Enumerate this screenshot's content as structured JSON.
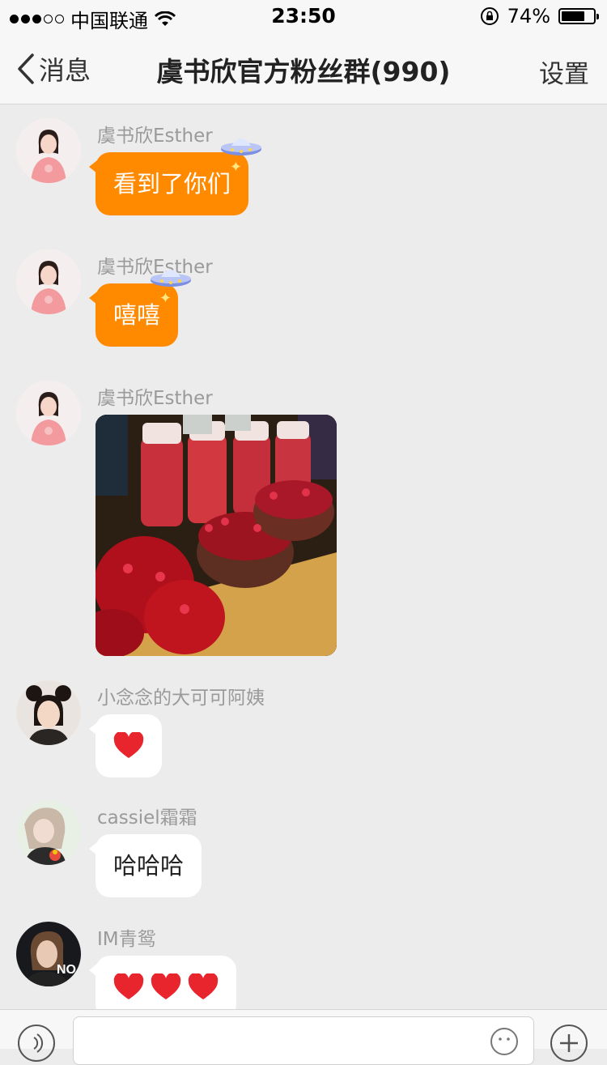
{
  "status_bar": {
    "carrier": "中国联通",
    "time": "23:50",
    "battery_percent": "74%",
    "battery_level": 0.74,
    "signal_dots_filled": 3,
    "signal_dots_total": 5
  },
  "nav": {
    "back_label": "消息",
    "title": "虞书欣官方粉丝群(990)",
    "settings_label": "设置"
  },
  "messages": [
    {
      "sender": "虞书欣Esther",
      "type": "text",
      "text": "看到了你们",
      "bubble_color": "#ff8a00",
      "avatar_icon": "avatar-esther-icon"
    },
    {
      "sender": "虞书欣Esther",
      "type": "text",
      "text": "嘻嘻",
      "bubble_color": "#ff8a00",
      "avatar_icon": "avatar-esther-icon"
    },
    {
      "sender": "虞书欣Esther",
      "type": "image",
      "image_icon": "pomegranate-juice-photo",
      "avatar_icon": "avatar-esther-icon"
    },
    {
      "sender": "小念念的大可可阿姨",
      "type": "emoji",
      "emoji": "heart-icon",
      "count": 1
    },
    {
      "sender": "cassiel霜霜",
      "type": "text",
      "text": "哈哈哈"
    },
    {
      "sender": "IM青鸳",
      "type": "emoji",
      "emoji": "heart-icon",
      "count": 3
    }
  ],
  "colors": {
    "accent_bubble": "#ff8a00",
    "background": "#ececec",
    "heart": "#e8242d"
  },
  "avatar_text": {
    "im_qingyuan": "NO"
  }
}
